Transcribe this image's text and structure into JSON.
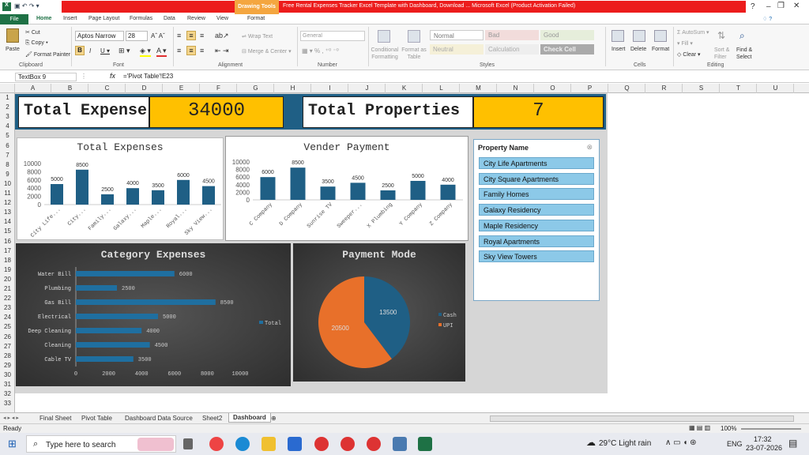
{
  "window": {
    "drawing_tools": "Drawing Tools",
    "title": "Free Rental Expenses Tracker Excel Template with Dashboard, Download ... Microsoft Excel (Product Activation Failed)",
    "format_tab": "Format"
  },
  "tabs": [
    "File",
    "Home",
    "Insert",
    "Page Layout",
    "Formulas",
    "Data",
    "Review",
    "View"
  ],
  "ribbon": {
    "paste": "Paste",
    "cut": "Cut",
    "copy": "Copy",
    "format_painter": "Format Painter",
    "clipboard": "Clipboard",
    "font_name": "Aptos Narrow",
    "font_size": "28",
    "font": "Font",
    "wrap_text": "Wrap Text",
    "merge_center": "Merge & Center",
    "alignment": "Alignment",
    "number_format": "General",
    "number": "Number",
    "conditional": "Conditional Formatting",
    "format_table": "Format as Table",
    "styles": {
      "normal": "Normal",
      "bad": "Bad",
      "good": "Good",
      "neutral": "Neutral",
      "calculation": "Calculation",
      "check_cell": "Check Cell"
    },
    "styles_label": "Styles",
    "insert": "Insert",
    "delete": "Delete",
    "format": "Format",
    "cells": "Cells",
    "autosum": "AutoSum",
    "fill": "Fill",
    "clear": "Clear",
    "sort_filter": "Sort & Filter",
    "find_select": "Find & Select",
    "editing": "Editing"
  },
  "formula_bar": {
    "name_box": "TextBox 9",
    "fx": "fx",
    "formula": "='Pivot Table'!E23"
  },
  "columns": [
    "A",
    "B",
    "C",
    "D",
    "E",
    "F",
    "G",
    "H",
    "I",
    "J",
    "K",
    "L",
    "M",
    "N",
    "O",
    "P",
    "Q",
    "R",
    "S",
    "T",
    "U"
  ],
  "rows": [
    "1",
    "2",
    "3",
    "4",
    "5",
    "6",
    "7",
    "8",
    "9",
    "10",
    "11",
    "12",
    "13",
    "14",
    "15",
    "16",
    "17",
    "18",
    "19",
    "20",
    "21",
    "22",
    "23",
    "24",
    "25",
    "26",
    "27",
    "28",
    "29",
    "30",
    "31",
    "32",
    "33"
  ],
  "kpi": {
    "expenses_label": "Total Expense",
    "expenses_value": "34000",
    "properties_label": "Total Properties",
    "properties_value": "7"
  },
  "total_expenses_chart": {
    "title": "Total Expenses",
    "yticks": [
      "10000",
      "8000",
      "6000",
      "4000",
      "2000",
      "0"
    ],
    "labels": [
      "City Life...",
      "City...",
      "Family...",
      "Galaxy...",
      "Maple...",
      "Royal...",
      "Sky View..."
    ],
    "values": [
      5000,
      8500,
      2500,
      4000,
      3500,
      6000,
      4500
    ],
    "color": "#1f5f85"
  },
  "vendor_chart": {
    "title": "Vender Payment",
    "yticks": [
      "10000",
      "8000",
      "6000",
      "4000",
      "2000",
      "0"
    ],
    "labels": [
      "C Company",
      "D Company",
      "Sunrise TV",
      "Sweeper...",
      "X Plumbing",
      "Y Company",
      "Z Company"
    ],
    "values": [
      6000,
      8500,
      3500,
      4500,
      2500,
      5000,
      4000
    ],
    "color": "#1f5f85"
  },
  "category_chart": {
    "title": "Category Expenses",
    "categories": [
      "Water Bill",
      "Plumbing",
      "Gas Bill",
      "Electrical",
      "Deep Cleaning",
      "Cleaning",
      "Cable TV"
    ],
    "values": [
      6000,
      2500,
      8500,
      5000,
      4000,
      4500,
      3500
    ],
    "xticks": [
      "0",
      "2000",
      "4000",
      "6000",
      "8000",
      "10000"
    ],
    "legend": "Total",
    "color": "#1f6fa0"
  },
  "payment_chart": {
    "title": "Payment Mode",
    "slices": [
      {
        "name": "Cash",
        "value": 13500,
        "label": "13500",
        "color": "#1f5f85"
      },
      {
        "name": "UPI",
        "value": 20500,
        "label": "20500",
        "color": "#e8702a"
      }
    ]
  },
  "slicer": {
    "title": "Property Name",
    "items": [
      "City Life Apartments",
      "City Square Apartments",
      "Family Homes",
      "Galaxy Residency",
      "Maple Residency",
      "Royal Apartments",
      "Sky View Towers"
    ]
  },
  "sheets": [
    "Final Sheet",
    "Pivot Table",
    "Dashboard Data Source",
    "Sheet2",
    "Dashboard"
  ],
  "status": {
    "ready": "Ready",
    "zoom": "100%"
  },
  "taskbar": {
    "search": "Type here to search",
    "weather": "29°C  Light rain",
    "lang": "ENG",
    "time": "17:32",
    "date": "23-07-2026"
  }
}
